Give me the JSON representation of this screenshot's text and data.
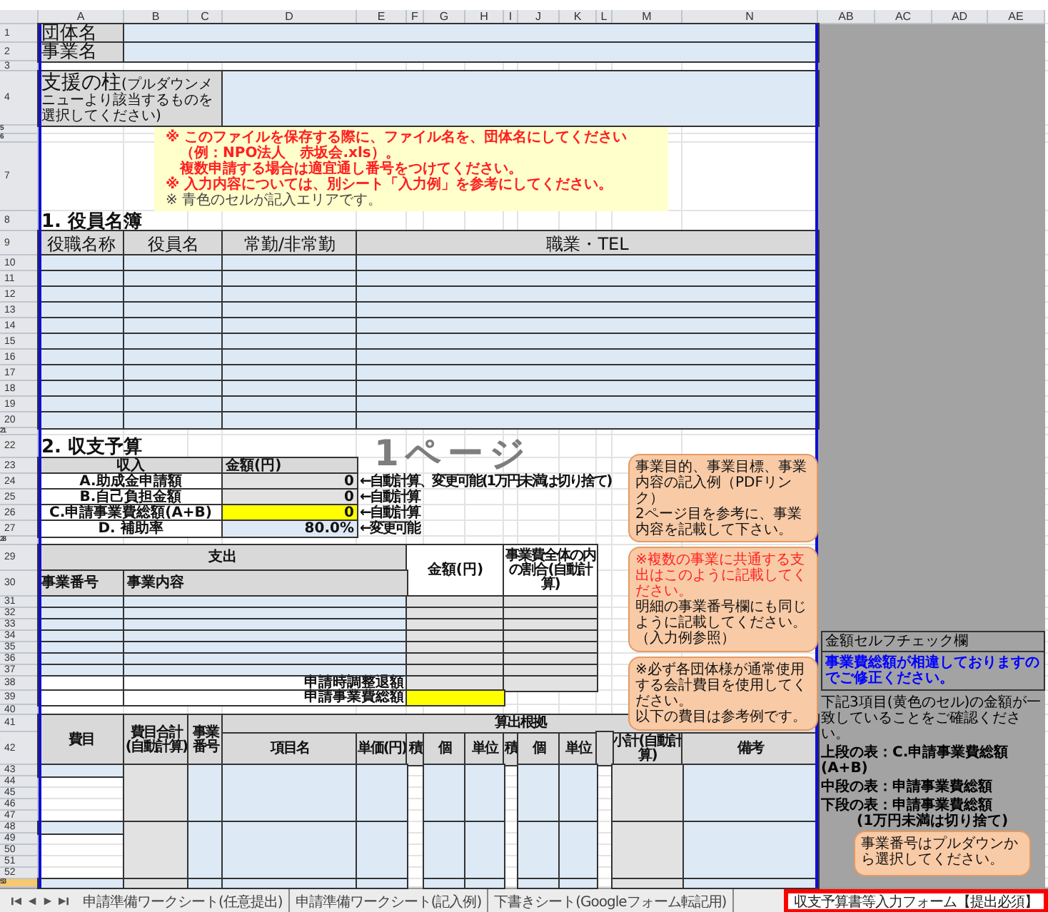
{
  "column_headers": [
    "A",
    "B",
    "C",
    "D",
    "E",
    "F",
    "G",
    "H",
    "I",
    "J",
    "K",
    "L",
    "M",
    "N",
    "AB",
    "AC",
    "AD",
    "AE"
  ],
  "row_headers": [
    {
      "label": "1",
      "selected": false
    },
    {
      "label": "2",
      "selected": false
    },
    {
      "label": "3",
      "selected": false
    },
    {
      "label": "4",
      "selected": false
    },
    {
      "label": "5",
      "selected": false
    },
    {
      "label": "6",
      "selected": false
    },
    {
      "label": "7",
      "selected": false
    },
    {
      "label": "8",
      "selected": false
    },
    {
      "label": "9",
      "selected": false
    },
    {
      "label": "10",
      "selected": false
    },
    {
      "label": "11",
      "selected": false
    },
    {
      "label": "12",
      "selected": false
    },
    {
      "label": "13",
      "selected": false
    },
    {
      "label": "14",
      "selected": false
    },
    {
      "label": "15",
      "selected": false
    },
    {
      "label": "16",
      "selected": false
    },
    {
      "label": "17",
      "selected": false
    },
    {
      "label": "18",
      "selected": false
    },
    {
      "label": "19",
      "selected": false
    },
    {
      "label": "20",
      "selected": false
    },
    {
      "label": "21",
      "selected": false
    },
    {
      "label": "22",
      "selected": false
    },
    {
      "label": "23",
      "selected": false
    },
    {
      "label": "24",
      "selected": false
    },
    {
      "label": "25",
      "selected": false
    },
    {
      "label": "26",
      "selected": false
    },
    {
      "label": "27",
      "selected": false
    },
    {
      "label": "28",
      "selected": false
    },
    {
      "label": "29",
      "selected": false
    },
    {
      "label": "30",
      "selected": false
    },
    {
      "label": "31",
      "selected": false
    },
    {
      "label": "32",
      "selected": false
    },
    {
      "label": "33",
      "selected": false
    },
    {
      "label": "34",
      "selected": false
    },
    {
      "label": "35",
      "selected": false
    },
    {
      "label": "36",
      "selected": false
    },
    {
      "label": "37",
      "selected": false
    },
    {
      "label": "38",
      "selected": false
    },
    {
      "label": "39",
      "selected": false
    },
    {
      "label": "40",
      "selected": false
    },
    {
      "label": "41",
      "selected": false
    },
    {
      "label": "42",
      "selected": false
    },
    {
      "label": "43",
      "selected": false
    },
    {
      "label": "44",
      "selected": false
    },
    {
      "label": "45",
      "selected": false
    },
    {
      "label": "46",
      "selected": false
    },
    {
      "label": "47",
      "selected": false
    },
    {
      "label": "48",
      "selected": false
    },
    {
      "label": "49",
      "selected": false
    },
    {
      "label": "50",
      "selected": false
    },
    {
      "label": "51",
      "selected": false
    },
    {
      "label": "52",
      "selected": false
    },
    {
      "label": "53",
      "selected": true
    }
  ],
  "header_fields": [
    {
      "label": "団体名"
    },
    {
      "label": "事業名"
    }
  ],
  "support_pillar": {
    "label": "支援の柱",
    "hint": "(プルダウンメニューより該当するものを選択してください)"
  },
  "notice": [
    {
      "kind": "warning",
      "text": "※ このファイルを保存する際に、ファイル名を、団体名にしてください"
    },
    {
      "kind": "continuation",
      "text": "（例：NPO法人　赤坂会.xls）。"
    },
    {
      "kind": "continuation",
      "text": "複数申請する場合は適宜通し番号をつけてください。"
    },
    {
      "kind": "warning",
      "text": "※ 入力内容については、別シート「入力例」を参考にしてください。"
    },
    {
      "kind": "info",
      "text": "※ 青色のセルが記入エリアです。"
    }
  ],
  "officers": {
    "title": "1. 役員名簿",
    "columns": [
      "役職名称",
      "役員名",
      "常勤/非常勤",
      "職業・TEL"
    ]
  },
  "budget": {
    "title": "2. 収支予算",
    "columns": [
      "収入",
      "金額(円)"
    ],
    "rows": [
      {
        "label": "A.助成金申請額",
        "amount": "0",
        "kind": "auto",
        "note": "←自動計算、変更可能(1万円未満は切り捨て)"
      },
      {
        "label": "B.自己負担金額",
        "amount": "0",
        "kind": "auto",
        "note": "←自動計算"
      },
      {
        "label": "C.申請事業費総額(A+B)",
        "amount": "0",
        "kind": "total",
        "note": "←自動計算"
      },
      {
        "label": "D. 補助率",
        "amount": "80.0%",
        "kind": "editable",
        "note": "←変更可能"
      }
    ]
  },
  "expenses": {
    "header": "支出",
    "columns": [
      "事業番号",
      "事業内容",
      "金額(円)",
      "事業費全体の内の割合(自動計算)"
    ],
    "adjustment_label": "申請時調整退額",
    "total_label": "申請事業費総額"
  },
  "details": {
    "group_header": "算出根拠",
    "columns": [
      "費目",
      "費目合計(自動計算)",
      "事業番号",
      "項目名",
      "単価(円)",
      "積",
      "個",
      "単位",
      "積",
      "個",
      "単位",
      "小計(自動計算)",
      "備考"
    ]
  },
  "callouts": [
    {
      "paragraphs": [
        {
          "kind": "normal",
          "text": "事業目的、事業目標、事業内容の記入例（PDFリンク）"
        },
        {
          "kind": "normal",
          "text": "2ページ目を参考に、事業内容を記載して下さい。"
        }
      ]
    },
    {
      "paragraphs": [
        {
          "kind": "warning",
          "text": "※複数の事業に共通する支出はこのように記載してください。"
        },
        {
          "kind": "normal",
          "text": "明細の事業番号欄にも同じように記載してください。（入力例参照）"
        }
      ]
    },
    {
      "paragraphs": [
        {
          "kind": "normal",
          "text": "※必ず各団体様が通常使用する会計費目を使用してください。"
        },
        {
          "kind": "normal",
          "text": "以下の費目は参考例です。"
        }
      ]
    },
    {
      "paragraphs": [
        {
          "kind": "normal",
          "text": "事業番号はプルダウンから選択してください。"
        }
      ]
    }
  ],
  "self_check": {
    "title": "金額セルフチェック欄",
    "alert": "事業費総額が相違しておりますのでご修正ください。",
    "instruction": "下記3項目(黄色のセル)の金額が一致していることをご確認ください。",
    "items": [
      "上段の表：C.申請事業費総額(A+B)",
      "中段の表：申請事業費総額",
      "下段の表：申請事業費総額"
    ],
    "footnote": "(1万円未満は切り捨て)"
  },
  "page_label": "1ページ",
  "sheet_tabs": [
    {
      "label": "申請準備ワークシート(任意提出)",
      "selected": false
    },
    {
      "label": "申請準備ワークシート(記入例)",
      "selected": false
    },
    {
      "label": "下書きシート(Googleフォーム転記用)",
      "selected": false
    },
    {
      "label": "収支予算書等入力フォーム【提出必須】",
      "selected": true
    }
  ]
}
